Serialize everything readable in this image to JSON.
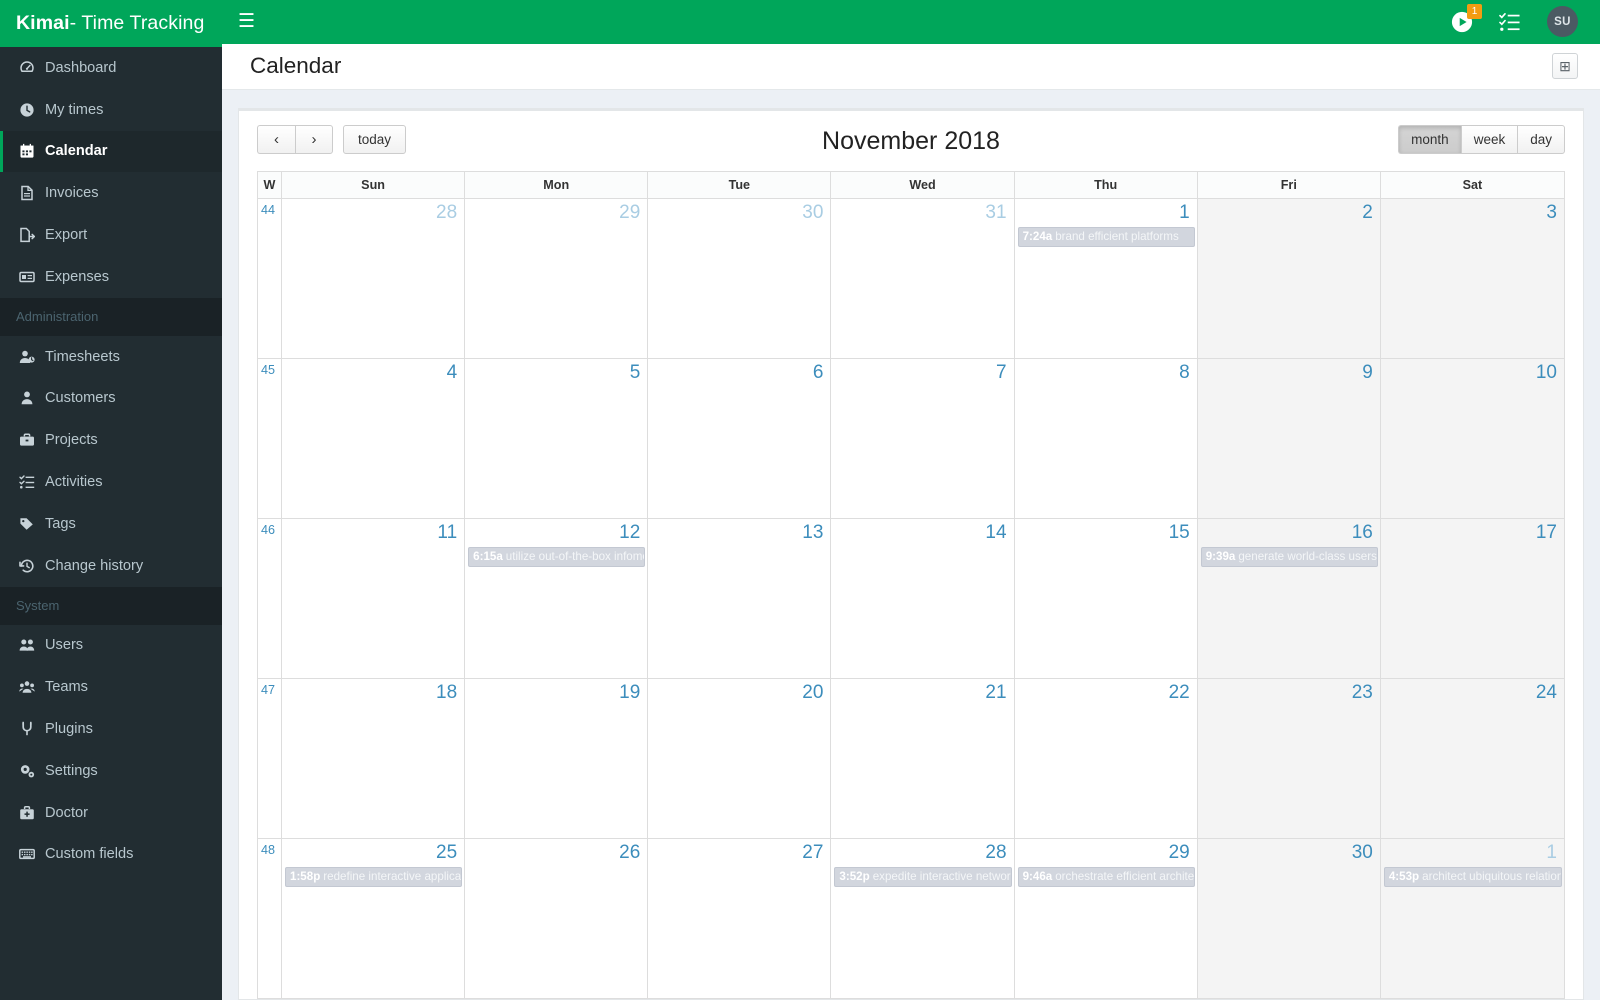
{
  "brand": {
    "strong": "Kimai",
    "rest": " - Time Tracking"
  },
  "topbar": {
    "menu_toggle_label": "☰",
    "running_timer_badge": "1",
    "avatar_initials": "SU"
  },
  "page": {
    "title": "Calendar",
    "action_button_label": "⊞"
  },
  "toolbar": {
    "prev_label": "‹",
    "next_label": "›",
    "today_label": "today",
    "title": "November 2018",
    "views": [
      {
        "label": "month",
        "active": true
      },
      {
        "label": "week",
        "active": false
      },
      {
        "label": "day",
        "active": false
      }
    ]
  },
  "sidebar": {
    "items": [
      {
        "label": "Dashboard",
        "icon": "dashboard-icon",
        "active": false
      },
      {
        "label": "My times",
        "icon": "clock-icon",
        "active": false
      },
      {
        "label": "Calendar",
        "icon": "calendar-icon",
        "active": true
      },
      {
        "label": "Invoices",
        "icon": "invoice-icon",
        "active": false
      },
      {
        "label": "Export",
        "icon": "export-icon",
        "active": false
      },
      {
        "label": "Expenses",
        "icon": "expenses-icon",
        "active": false
      }
    ],
    "admin_header": "Administration",
    "admin_items": [
      {
        "label": "Timesheets",
        "icon": "timesheet-user-icon"
      },
      {
        "label": "Customers",
        "icon": "customer-icon"
      },
      {
        "label": "Projects",
        "icon": "briefcase-icon"
      },
      {
        "label": "Activities",
        "icon": "tasks-icon"
      },
      {
        "label": "Tags",
        "icon": "tag-icon"
      },
      {
        "label": "Change history",
        "icon": "history-icon"
      }
    ],
    "system_header": "System",
    "system_items": [
      {
        "label": "Users",
        "icon": "users-icon"
      },
      {
        "label": "Teams",
        "icon": "teams-icon"
      },
      {
        "label": "Plugins",
        "icon": "plug-icon"
      },
      {
        "label": "Settings",
        "icon": "gears-icon"
      },
      {
        "label": "Doctor",
        "icon": "medkit-icon"
      },
      {
        "label": "Custom fields",
        "icon": "keyboard-icon"
      }
    ]
  },
  "calendar": {
    "week_col_header": "W",
    "day_headers": [
      "Sun",
      "Mon",
      "Tue",
      "Wed",
      "Thu",
      "Fri",
      "Sat"
    ],
    "weekend_columns": [
      5,
      6
    ],
    "weeks": [
      {
        "week_number": "44",
        "days": [
          {
            "num": "28",
            "other_month": true,
            "events": []
          },
          {
            "num": "29",
            "other_month": true,
            "events": []
          },
          {
            "num": "30",
            "other_month": true,
            "events": []
          },
          {
            "num": "31",
            "other_month": true,
            "events": []
          },
          {
            "num": "1",
            "other_month": false,
            "events": [
              {
                "time": "7:24a",
                "title": "brand efficient platforms"
              }
            ]
          },
          {
            "num": "2",
            "other_month": false,
            "events": []
          },
          {
            "num": "3",
            "other_month": false,
            "events": []
          }
        ]
      },
      {
        "week_number": "45",
        "days": [
          {
            "num": "4",
            "other_month": false,
            "events": []
          },
          {
            "num": "5",
            "other_month": false,
            "events": []
          },
          {
            "num": "6",
            "other_month": false,
            "events": []
          },
          {
            "num": "7",
            "other_month": false,
            "events": []
          },
          {
            "num": "8",
            "other_month": false,
            "events": []
          },
          {
            "num": "9",
            "other_month": false,
            "events": []
          },
          {
            "num": "10",
            "other_month": false,
            "events": []
          }
        ]
      },
      {
        "week_number": "46",
        "days": [
          {
            "num": "11",
            "other_month": false,
            "events": []
          },
          {
            "num": "12",
            "other_month": false,
            "events": [
              {
                "time": "6:15a",
                "title": "utilize out-of-the-box infomediaries"
              }
            ]
          },
          {
            "num": "13",
            "other_month": false,
            "events": []
          },
          {
            "num": "14",
            "other_month": false,
            "events": []
          },
          {
            "num": "15",
            "other_month": false,
            "events": []
          },
          {
            "num": "16",
            "other_month": false,
            "events": [
              {
                "time": "9:39a",
                "title": "generate world-class users"
              }
            ]
          },
          {
            "num": "17",
            "other_month": false,
            "events": []
          }
        ]
      },
      {
        "week_number": "47",
        "days": [
          {
            "num": "18",
            "other_month": false,
            "events": []
          },
          {
            "num": "19",
            "other_month": false,
            "events": []
          },
          {
            "num": "20",
            "other_month": false,
            "events": []
          },
          {
            "num": "21",
            "other_month": false,
            "events": []
          },
          {
            "num": "22",
            "other_month": false,
            "events": []
          },
          {
            "num": "23",
            "other_month": false,
            "events": []
          },
          {
            "num": "24",
            "other_month": false,
            "events": []
          }
        ]
      },
      {
        "week_number": "48",
        "days": [
          {
            "num": "25",
            "other_month": false,
            "events": [
              {
                "time": "1:58p",
                "title": "redefine interactive applications"
              }
            ]
          },
          {
            "num": "26",
            "other_month": false,
            "events": []
          },
          {
            "num": "27",
            "other_month": false,
            "events": []
          },
          {
            "num": "28",
            "other_month": false,
            "events": [
              {
                "time": "3:52p",
                "title": "expedite interactive networks"
              }
            ]
          },
          {
            "num": "29",
            "other_month": false,
            "events": [
              {
                "time": "9:46a",
                "title": "orchestrate efficient architectures"
              }
            ]
          },
          {
            "num": "30",
            "other_month": false,
            "events": []
          },
          {
            "num": "1",
            "other_month": true,
            "events": [
              {
                "time": "4:53p",
                "title": "architect ubiquitous relationships"
              }
            ]
          }
        ]
      }
    ]
  }
}
